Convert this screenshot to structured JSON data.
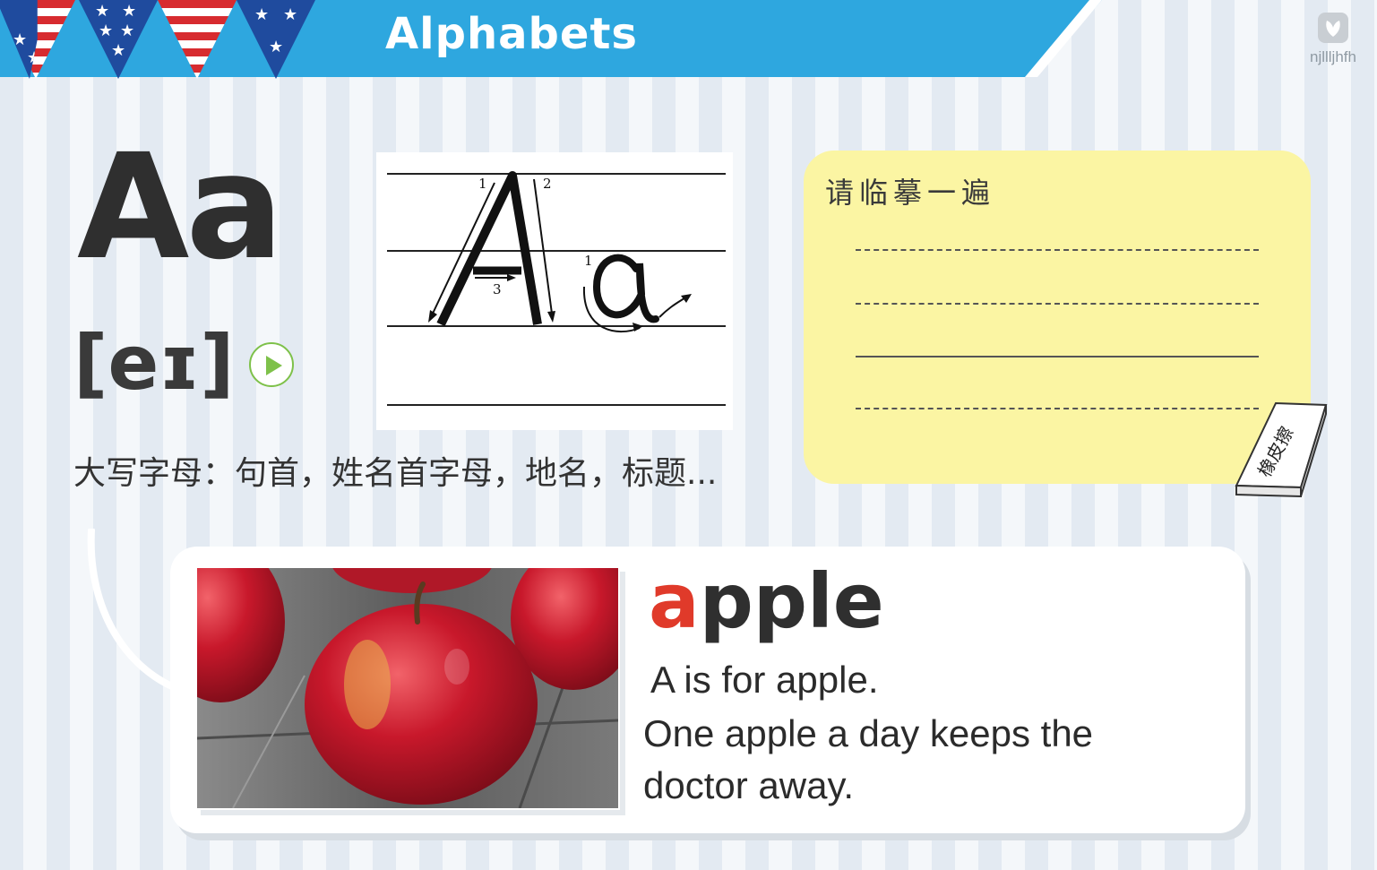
{
  "header": {
    "title": "Alphabets",
    "logo_text": "njllljhfh",
    "colors": {
      "band": "#2ea7df",
      "flag_red": "#d72b2f",
      "flag_blue": "#1f4b9e"
    }
  },
  "letter": {
    "display": "Aa",
    "phonetic": "[eɪ]",
    "usage_note": "大写字母：句首，姓名首字母，地名，标题..."
  },
  "handwriting": {
    "stroke_numbers": [
      "1",
      "2",
      "3",
      "1"
    ]
  },
  "trace_note": {
    "title": "请临摹一遍",
    "eraser_label": "橡皮擦"
  },
  "word_card": {
    "word_highlight": "a",
    "word_rest": "pple",
    "sentence1": "A is for apple.",
    "sentence2": "One apple a day keeps the doctor away.",
    "accent_color": "#e03a2a"
  },
  "icons": [
    "play-icon",
    "logo-icon",
    "eraser-icon",
    "star-icon"
  ]
}
